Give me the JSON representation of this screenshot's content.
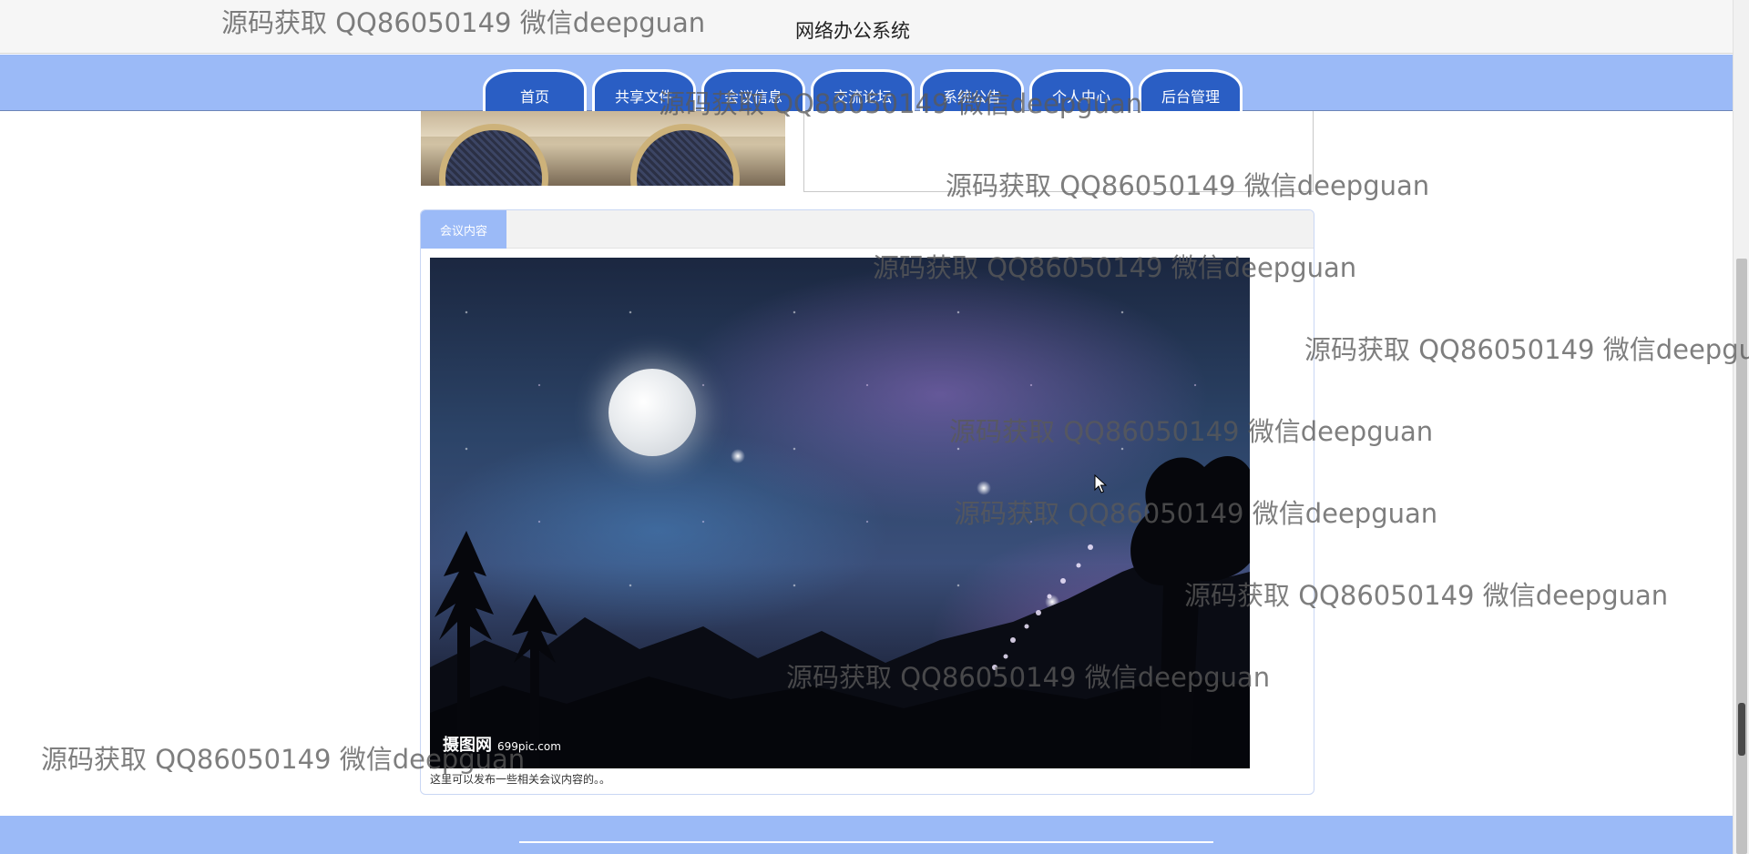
{
  "header": {
    "title": "网络办公系统"
  },
  "nav": {
    "tabs": [
      {
        "label": "首页"
      },
      {
        "label": "共享文件"
      },
      {
        "label": "会议信息"
      },
      {
        "label": "交流论坛"
      },
      {
        "label": "系统公告"
      },
      {
        "label": "个人中心"
      },
      {
        "label": "后台管理"
      }
    ]
  },
  "panel": {
    "tab_label": "会议内容",
    "image_watermark_brand": "摄图网",
    "image_watermark_site": "699pic.com",
    "description": "这里可以发布一些相关会议内容的。。"
  },
  "overlay": {
    "text": "源码获取 QQ86050149 微信deepguan"
  },
  "colors": {
    "nav_bg": "#9bbaf7",
    "tab_bg": "#2a5ec4",
    "footer_bg": "#9bbaf7"
  }
}
